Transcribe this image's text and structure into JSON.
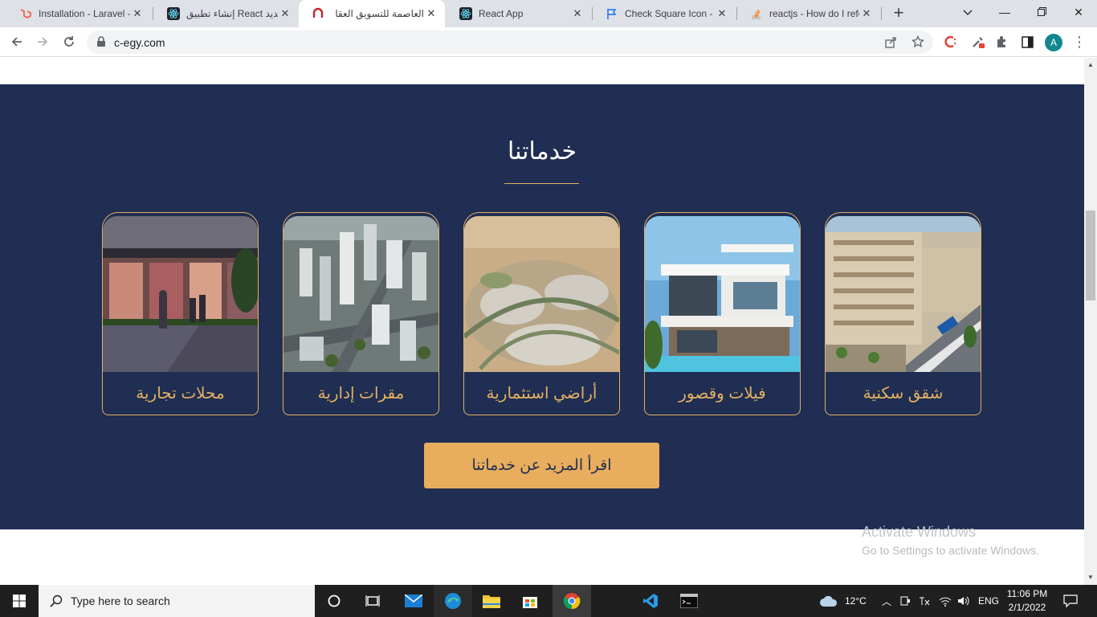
{
  "tabs": [
    {
      "title": "Installation - Laravel -",
      "icon": "laravel-icon"
    },
    {
      "title": "إنشاء تطبيق React جديد",
      "icon": "react-icon"
    },
    {
      "title": "العاصمة للتسويق العقا",
      "icon": "omega-icon"
    },
    {
      "title": "React App",
      "icon": "react-icon"
    },
    {
      "title": "Check Square Icon - R",
      "icon": "flag-icon"
    },
    {
      "title": "reactjs - How do I refe",
      "icon": "stackoverflow-icon"
    }
  ],
  "address": {
    "url": "c-egy.com"
  },
  "profile": {
    "initial": "A"
  },
  "services": {
    "title": "خدماتنا",
    "cards": [
      {
        "label": "محلات تجارية",
        "icon": "storefront-image"
      },
      {
        "label": "مقرات إدارية",
        "icon": "city-towers-image"
      },
      {
        "label": "أراضي استثمارية",
        "icon": "land-aerial-image"
      },
      {
        "label": "فيلات وقصور",
        "icon": "villa-pool-image"
      },
      {
        "label": "شقق سكنية",
        "icon": "apartments-image"
      }
    ],
    "cta_label": "اقرأ المزيد عن خدماتنا"
  },
  "watermark": {
    "line1": "Activate Windows",
    "line2": "Go to Settings to activate Windows."
  },
  "taskbar": {
    "search_placeholder": "Type here to search",
    "weather": "12°C",
    "language": "ENG",
    "time": "11:06 PM",
    "date": "2/1/2022"
  },
  "colors": {
    "navy": "#1f2e52",
    "gold": "#e4b062",
    "button": "#e8ad5d"
  }
}
